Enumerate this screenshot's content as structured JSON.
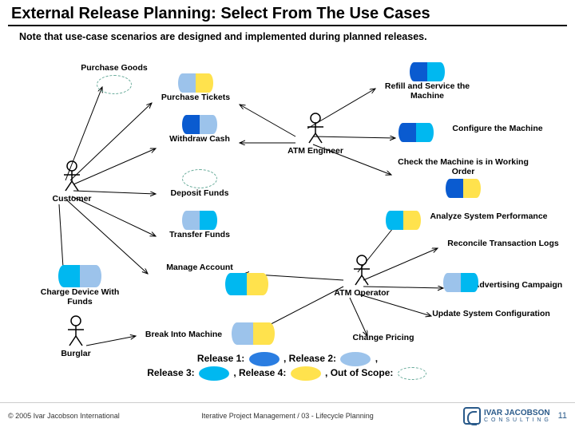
{
  "title": "External Release Planning: Select From The Use Cases",
  "note": "Note that use-case scenarios are designed and implemented during planned releases.",
  "actors": {
    "customer": "Customer",
    "atm_engineer": "ATM Engineer",
    "atm_operator": "ATM Operator",
    "burglar": "Burglar"
  },
  "usecases": {
    "purchase_goods": "Purchase Goods",
    "purchase_tickets": "Purchase Tickets",
    "withdraw_cash": "Withdraw Cash",
    "deposit_funds": "Deposit Funds",
    "transfer_funds": "Transfer Funds",
    "manage_account": "Manage Account",
    "charge_device": "Charge Device With Funds",
    "break_into": "Break Into Machine",
    "refill_service": "Refill and Service the Machine",
    "configure": "Configure the Machine",
    "check_working": "Check the Machine is in Working Order",
    "analyze_perf": "Analyze System Performance",
    "reconcile": "Reconcile Transaction Logs",
    "run_ads": "Run Advertising Campaign",
    "update_config": "Update System Configuration",
    "change_pricing": "Change Pricing"
  },
  "legend": {
    "r1": "Release 1:",
    "r2": ", Release 2:",
    "r3": "Release 3:",
    "r4": ", Release 4:",
    "oos": ", Out of Scope:"
  },
  "footer": {
    "copyright": "© 2005 Ivar Jacobson International",
    "center": "Iterative Project Management / 03 - Lifecycle Planning",
    "brand1": "IVAR JACOBSON",
    "brand2": "C O N S U L T I N G",
    "page": "11"
  },
  "colors": {
    "r1": "#2a7de1",
    "r2": "#9cc3eb",
    "r3": "#00b8f0",
    "r4": "#ffe24d"
  }
}
